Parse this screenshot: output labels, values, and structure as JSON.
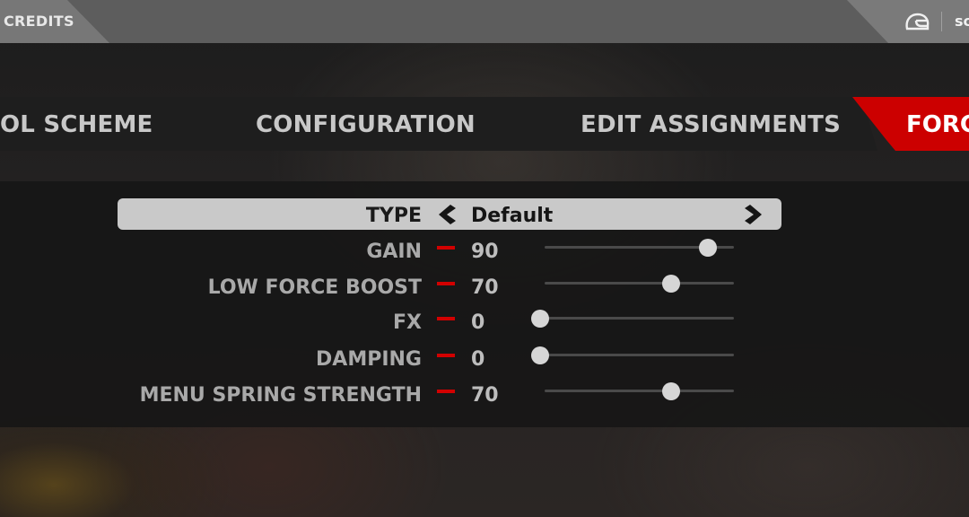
{
  "topbar": {
    "left_label": "CREDITS",
    "right_label": "sc",
    "icons": [
      "helmet-icon"
    ]
  },
  "tabs": [
    {
      "label": "OL SCHEME",
      "active": false
    },
    {
      "label": "CONFIGURATION",
      "active": false
    },
    {
      "label": "EDIT ASSIGNMENTS",
      "active": false
    },
    {
      "label": "FORC",
      "active": true
    }
  ],
  "type_selector": {
    "label": "TYPE",
    "value": "Default",
    "icons": [
      "chevron-left-icon",
      "chevron-right-icon"
    ]
  },
  "settings": [
    {
      "label": "GAIN",
      "value": "90",
      "level": 90
    },
    {
      "label": "LOW FORCE BOOST",
      "value": "70",
      "level": 70
    },
    {
      "label": "FX",
      "value": "0",
      "level": 0
    },
    {
      "label": "DAMPING",
      "value": "0",
      "level": 0
    },
    {
      "label": "MENU SPRING STRENGTH",
      "value": "70",
      "level": 70
    }
  ],
  "colors": {
    "accent": "#cc0000",
    "decrement": "#d20000",
    "selected_row": "#c9c9c9"
  }
}
